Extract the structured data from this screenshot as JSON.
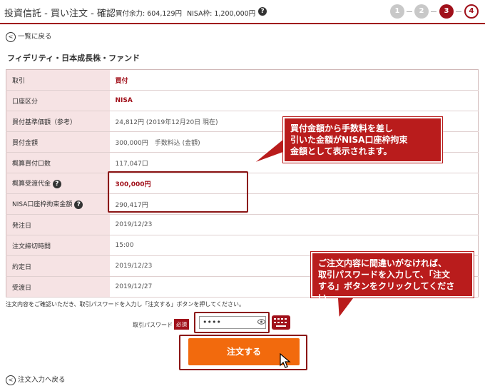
{
  "header": {
    "title": "投資信託 - 買い注文 - 確認",
    "balance": "買付余力: 604,129円",
    "nisa": "NISA枠: 1,200,000円",
    "help_icon": "question-icon",
    "steps": [
      "1",
      "2",
      "3",
      "4"
    ],
    "current_step": 3
  },
  "back_top": "一覧に戻る",
  "fund_name": "フィデリティ・日本成長株・ファンド",
  "table": {
    "rows": [
      {
        "label": "取引",
        "value": "買付"
      },
      {
        "label": "口座区分",
        "value": "NISA"
      },
      {
        "label": "買付基準価額（参考）",
        "value": "24,812円 (2019年12月20日 現在)"
      },
      {
        "label": "買付金額",
        "value": "300,000円　手数料込 (金額)"
      },
      {
        "label": "概算買付口数",
        "value": "117,047口"
      },
      {
        "label": "概算受渡代金",
        "value": "300,000円"
      },
      {
        "label": "NISA口座枠拘束金額",
        "value": "290,417円"
      },
      {
        "label": "発注日",
        "value": "2019/12/23"
      },
      {
        "label": "注文締切時間",
        "value": "15:00"
      },
      {
        "label": "約定日",
        "value": "2019/12/23"
      },
      {
        "label": "受渡日",
        "value": "2019/12/27"
      }
    ]
  },
  "callouts": {
    "c1": [
      "買付金額から手数料を差し",
      "引いた金額がNISA口座枠拘束",
      "金額として表示されます。"
    ],
    "c2": [
      "ご注文内容に間違いがなければ、",
      "取引パスワードを入力して、「注文",
      "する」ボタンをクリックしてください。"
    ]
  },
  "note": "注文内容をご確認いただき、取引パスワードを入力し「注文する」ボタンを押してください。",
  "password": {
    "label": "取引パスワード",
    "required": "必須",
    "value": "••••"
  },
  "submit_label": "注文する",
  "back_bottom": "注文入力へ戻る",
  "colors": {
    "brand": "#a0101a",
    "submit": "#f26a0d",
    "label_bg": "#f6e3e4"
  }
}
